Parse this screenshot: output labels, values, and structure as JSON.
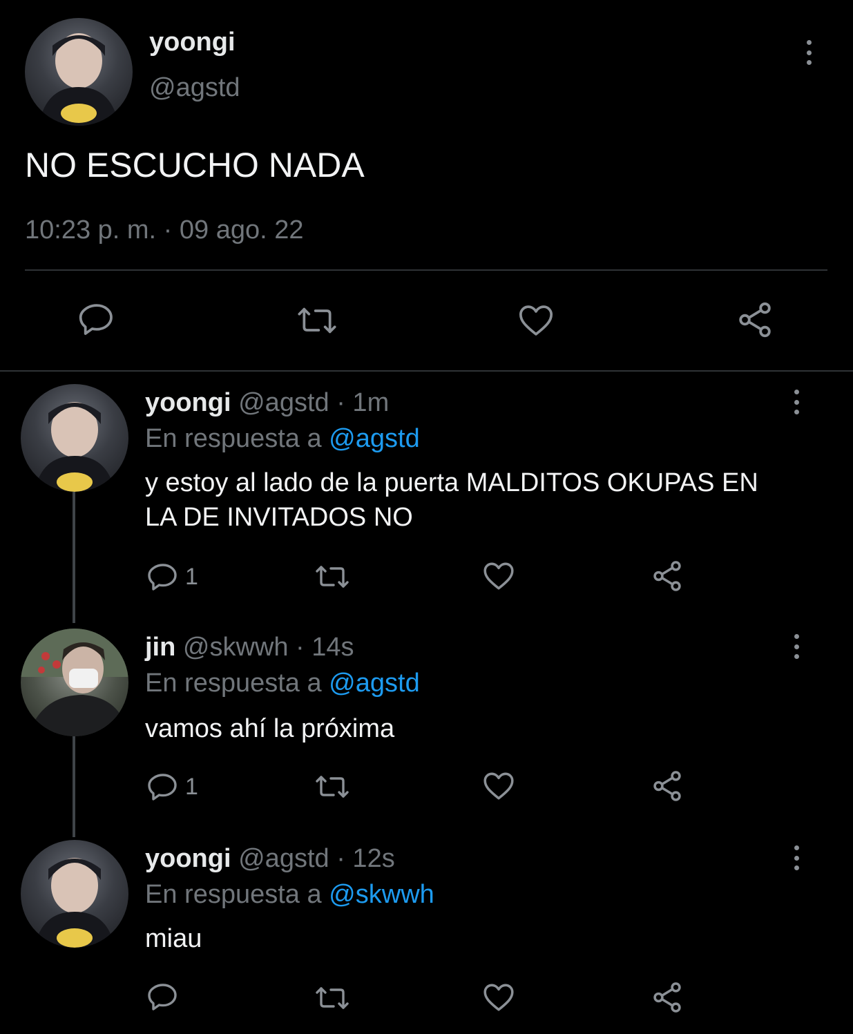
{
  "main_tweet": {
    "display_name": "yoongi",
    "handle": "@agstd",
    "text": "NO ESCUCHO NADA",
    "timestamp": "10:23 p. m. · 09 ago. 22",
    "actions": [
      "reply-icon",
      "retweet-icon",
      "like-icon",
      "share-icon"
    ]
  },
  "replies": [
    {
      "display_name": "yoongi",
      "handle": "@agstd",
      "time": "· 1m",
      "reply_prefix": "En respuesta a",
      "reply_to": "@agstd",
      "text_line1": "y estoy al lado de la puerta MALDITOS OKUPAS EN",
      "text_line2": "LA DE INVITADOS NO",
      "reply_count": "1"
    },
    {
      "display_name": "jin",
      "handle": "@skwwh",
      "time": "· 14s",
      "reply_prefix": "En respuesta a",
      "reply_to": "@agstd",
      "text_line1": "vamos ahí la próxima",
      "reply_count": "1"
    },
    {
      "display_name": "yoongi",
      "handle": "@agstd",
      "time": "· 12s",
      "reply_prefix": "En respuesta a",
      "reply_to": "@skwwh",
      "text_line1": "miau",
      "reply_count": ""
    }
  ],
  "colors": {
    "background": "#000000",
    "text": "#e7e9ea",
    "muted": "#71767b",
    "link": "#1d9bf0",
    "icon": "#8b9096"
  }
}
